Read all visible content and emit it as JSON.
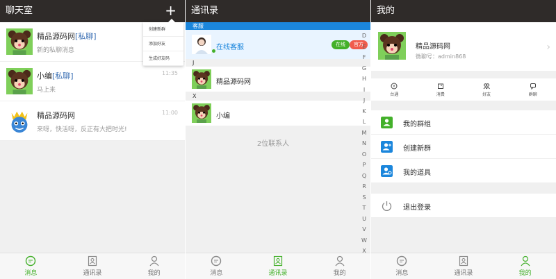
{
  "chat": {
    "title": "聊天室",
    "plus_label": "+",
    "popup": [
      "创建新群",
      "添加好友",
      "生成好友码"
    ],
    "items": [
      {
        "name": "精品源码网",
        "tag": "[私聊]",
        "msg": "新的私聊消息",
        "time": ""
      },
      {
        "name": "小编",
        "tag": "[私聊]",
        "msg": "马上来",
        "time": "11:35"
      },
      {
        "name": "精品源码网",
        "tag": "",
        "msg": "来呀，快活呀，反正有大把时光!",
        "time": "11:00"
      }
    ]
  },
  "contacts": {
    "title": "通讯录",
    "service_header": "客服",
    "service_name": "在线客服",
    "badge_online": "在线",
    "badge_official": "官方",
    "sections": [
      {
        "letter": "J",
        "name": "精品源码网"
      },
      {
        "letter": "X",
        "name": "小编"
      }
    ],
    "count": "2位联系人",
    "alphabet": [
      "D",
      "E",
      "F",
      "G",
      "H",
      "I",
      "J",
      "K",
      "L",
      "M",
      "N",
      "O",
      "P",
      "Q",
      "R",
      "S",
      "T",
      "U",
      "V",
      "W",
      "X"
    ]
  },
  "mine": {
    "title": "我的",
    "name": "精品源码网",
    "id": "微聊号：admin868",
    "quick": [
      "台通",
      "消费",
      "好友",
      "群聊"
    ],
    "menu": [
      "我的群组",
      "创建新群",
      "我的道具"
    ],
    "logout": "退出登录"
  },
  "tabs": [
    "消息",
    "通讯录",
    "我的"
  ],
  "colors": {
    "accent": "#43b02a",
    "topbar": "#2f2b29",
    "blue": "#1b86dc",
    "online": "#43b02a",
    "official": "#f05c4d"
  }
}
